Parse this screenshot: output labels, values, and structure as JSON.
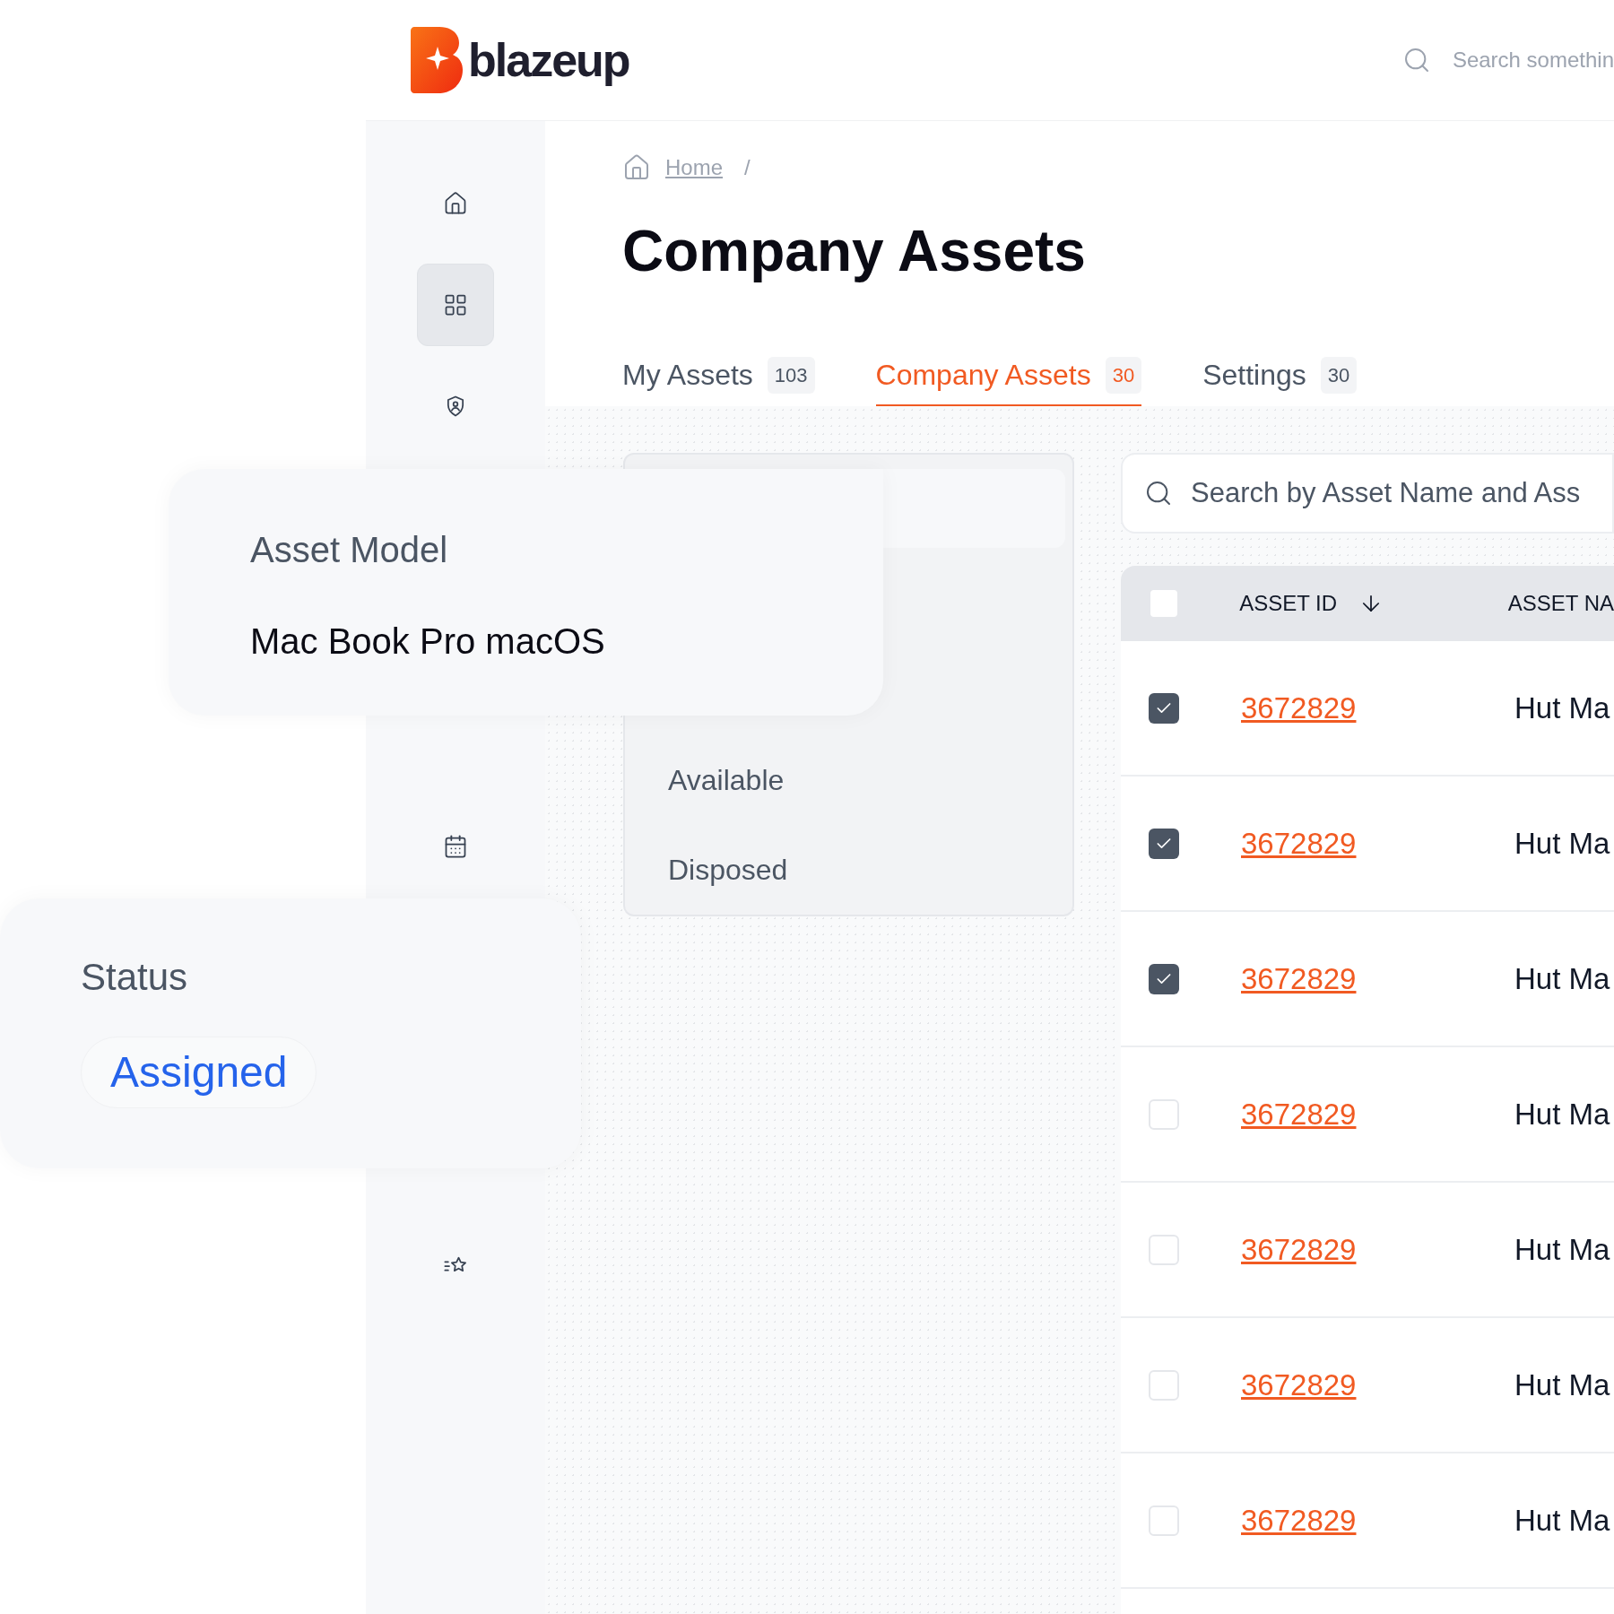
{
  "header": {
    "logo": "blazeup",
    "search_placeholder": "Search somethin"
  },
  "sidebar": {
    "items": [
      {
        "kind": "home",
        "selected": false
      },
      {
        "kind": "grid",
        "selected": true
      },
      {
        "kind": "shield",
        "selected": false
      },
      {
        "kind": "calendar",
        "selected": false
      },
      {
        "kind": "star-list",
        "selected": false
      }
    ]
  },
  "breadcrumb": {
    "items": [
      "Home"
    ],
    "separator": "/"
  },
  "title": "Company Assets",
  "tabs": [
    {
      "label": "My Assets",
      "count": "103",
      "selected": false
    },
    {
      "label": "Company Assets",
      "count": "30",
      "selected": true
    },
    {
      "label": "Settings",
      "count": "30",
      "selected": false
    }
  ],
  "filter_panel": {
    "options": [
      "Available",
      "Disposed"
    ]
  },
  "search": {
    "placeholder": "Search by Asset Name and Ass"
  },
  "table": {
    "select_all": {
      "checked": false
    },
    "columns": [
      "ASSET ID",
      "ASSET NA"
    ],
    "rows": [
      {
        "checked": true,
        "asset_id": "3672829",
        "asset_name": "Hut Ma"
      },
      {
        "checked": true,
        "asset_id": "3672829",
        "asset_name": "Hut Ma"
      },
      {
        "checked": true,
        "asset_id": "3672829",
        "asset_name": "Hut Ma"
      },
      {
        "checked": false,
        "asset_id": "3672829",
        "asset_name": "Hut Ma"
      },
      {
        "checked": false,
        "asset_id": "3672829",
        "asset_name": "Hut Ma"
      },
      {
        "checked": false,
        "asset_id": "3672829",
        "asset_name": "Hut Ma"
      },
      {
        "checked": false,
        "asset_id": "3672829",
        "asset_name": "Hut Ma"
      }
    ]
  },
  "asset_model_card": {
    "label": "Asset Model",
    "value": "Mac Book Pro macOS"
  },
  "status_card": {
    "label": "Status",
    "value": "Assigned"
  }
}
